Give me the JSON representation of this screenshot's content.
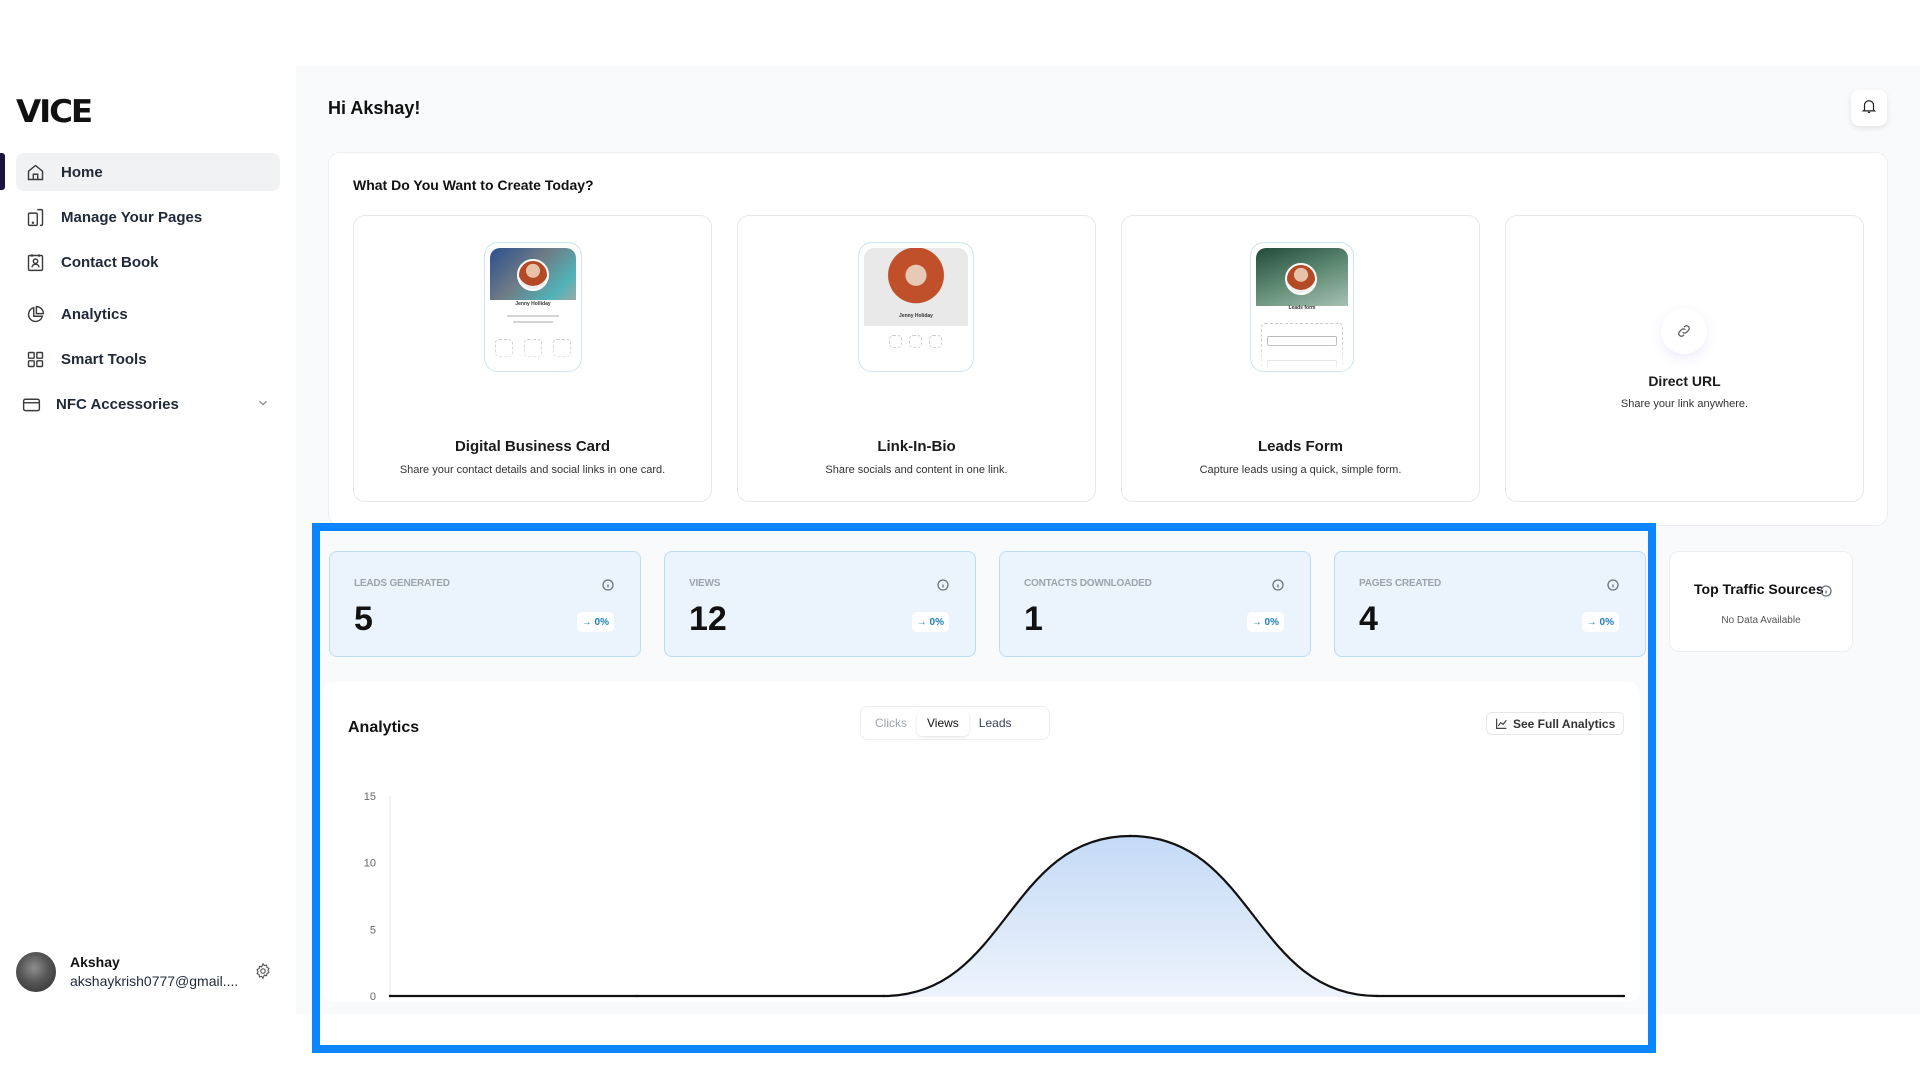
{
  "brand": {
    "logo": "VICE",
    "accent": "#0a84ff"
  },
  "sidebar": {
    "items": [
      {
        "label": "Home",
        "icon": "home-icon",
        "active": true
      },
      {
        "label": "Manage Your Pages",
        "icon": "pages-icon"
      },
      {
        "label": "Contact Book",
        "icon": "contact-book-icon"
      },
      {
        "label": "Analytics",
        "icon": "pie-chart-icon"
      },
      {
        "label": "Smart Tools",
        "icon": "grid-icon"
      },
      {
        "label": "NFC Accessories",
        "icon": "card-icon",
        "expandable": true
      }
    ],
    "user": {
      "name": "Akshay",
      "email": "akshaykrish0777@gmail...."
    }
  },
  "header": {
    "greeting": "Hi Akshay!",
    "notifications_icon": "bell-icon"
  },
  "create": {
    "title": "What Do You Want to Create Today?",
    "cards": [
      {
        "title": "Digital Business Card",
        "description": "Share your contact details and social links in one card.",
        "preview_name": "Jenny Holliday"
      },
      {
        "title": "Link-In-Bio",
        "description": "Share socials and content in one link.",
        "preview_name": "Jenny Holiday"
      },
      {
        "title": "Leads Form",
        "description": "Capture leads using a quick, simple form.",
        "preview_name": "Leads form"
      },
      {
        "title": "Direct URL",
        "description": "Share your link anywhere.",
        "icon": "link-icon"
      }
    ]
  },
  "stats": [
    {
      "label": "LEADS GENERATED",
      "value": "5",
      "change": "0%"
    },
    {
      "label": "VIEWS",
      "value": "12",
      "change": "0%"
    },
    {
      "label": "CONTACTS DOWNLOADED",
      "value": "1",
      "change": "0%"
    },
    {
      "label": "PAGES CREATED",
      "value": "4",
      "change": "0%"
    }
  ],
  "traffic": {
    "title": "Top Traffic Sources",
    "empty": "No Data Available"
  },
  "analytics": {
    "title": "Analytics",
    "tabs": [
      {
        "label": "Clicks",
        "state": "muted"
      },
      {
        "label": "Views",
        "state": "active"
      },
      {
        "label": "Leads",
        "state": "default"
      }
    ],
    "full_button": "See Full Analytics"
  },
  "chart_data": {
    "type": "area",
    "title": "Analytics",
    "series": [
      {
        "name": "Views",
        "values": [
          0,
          0,
          0,
          12,
          0,
          0
        ]
      }
    ],
    "x": [
      0,
      1,
      2,
      3,
      4,
      5
    ],
    "xlabel": "",
    "ylabel": "",
    "yticks": [
      0,
      5,
      10,
      15
    ],
    "ylim": [
      0,
      15
    ],
    "grid": false,
    "line_color": "#111111",
    "fill_color": "#c9ddf7"
  }
}
